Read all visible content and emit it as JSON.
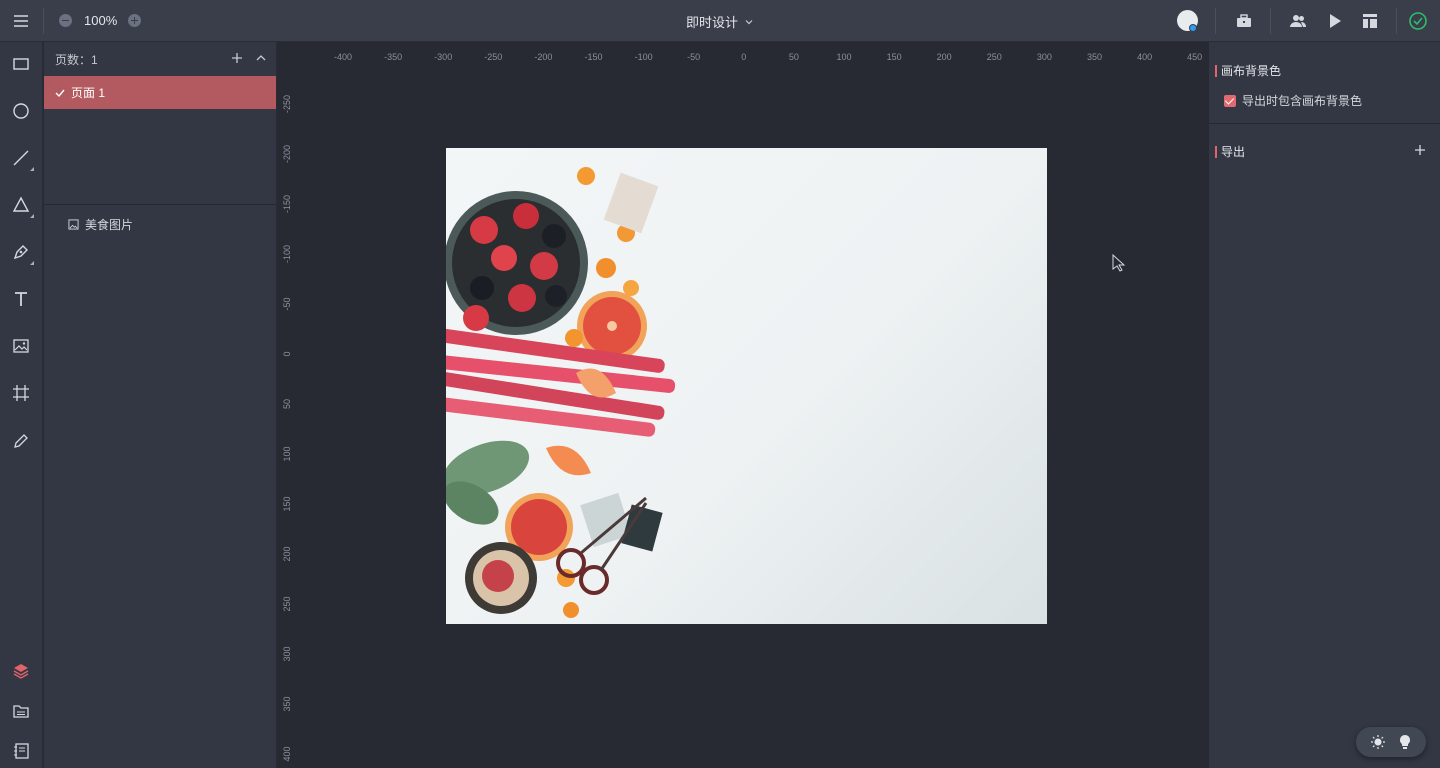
{
  "topbar": {
    "zoom": "100%",
    "title": "即时设计",
    "icons": [
      "menu-icon",
      "zoom-out-icon",
      "zoom-in-icon",
      "chevron-down-icon",
      "avatar",
      "toolbox-icon",
      "users-icon",
      "play-icon",
      "layout-icon",
      "saved-check-icon"
    ],
    "accent_color": "#2ebd6b"
  },
  "toolbar": {
    "tools": [
      "rectangle-icon",
      "ellipse-icon",
      "line-icon",
      "triangle-icon",
      "pen-icon",
      "text-icon",
      "image-icon",
      "artboard-icon",
      "pencil-icon"
    ],
    "bottom_tools": [
      "layers-icon",
      "assets-icon",
      "notes-icon"
    ],
    "active_color": "#e0646a"
  },
  "pages": {
    "header": "页数：1",
    "items": [
      {
        "label": "页面 1",
        "selected": true
      }
    ],
    "selected_color": "#b35a60"
  },
  "layers": {
    "items": [
      {
        "label": "美食图片",
        "icon": "image-icon"
      }
    ]
  },
  "rulers": {
    "horizontal": [
      "-400",
      "-350",
      "-300",
      "-250",
      "-200",
      "-150",
      "-100",
      "-50",
      "0",
      "50",
      "100",
      "150",
      "200",
      "250",
      "300",
      "350",
      "400",
      "450"
    ],
    "vertical": [
      "-250",
      "-200",
      "-150",
      "-100",
      "-50",
      "0",
      "50",
      "100",
      "150",
      "200",
      "250",
      "300",
      "350",
      "400"
    ]
  },
  "properties": {
    "background_section": "画布背景色",
    "export_background_label": "导出时包含画布背景色",
    "export_background_checked": true,
    "export_section": "导出"
  },
  "floating": {
    "icons": [
      "theme-sun-icon",
      "lightbulb-icon"
    ]
  }
}
